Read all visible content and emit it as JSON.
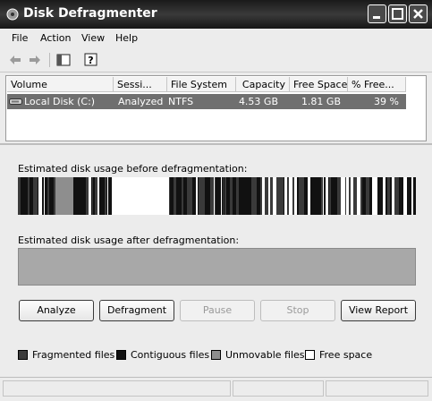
{
  "window": {
    "title": "Disk Defragmenter"
  },
  "menu": [
    "File",
    "Action",
    "View",
    "Help"
  ],
  "toolbar": {
    "back": "back-arrow-icon",
    "forward": "forward-arrow-icon",
    "show_hide": "show-hide-console-tree-icon",
    "help": "help-icon"
  },
  "table": {
    "columns": [
      "Volume",
      "Sessi...",
      "File System",
      "Capacity",
      "Free Space",
      "% Free..."
    ],
    "rows": [
      {
        "volume": "Local Disk (C:)",
        "session": "Analyzed",
        "file_system": "NTFS",
        "capacity": "4.53 GB",
        "free_space": "1.81 GB",
        "percent_free": "39 %"
      }
    ]
  },
  "before_label": "Estimated disk usage before defragmentation:",
  "after_label": "Estimated disk usage after defragmentation:",
  "buttons": {
    "analyze": "Analyze",
    "defragment": "Defragment",
    "pause": "Pause",
    "stop": "Stop",
    "view_report": "View Report"
  },
  "legend": [
    {
      "label": "Fragmented files",
      "color": "#3a3a3a"
    },
    {
      "label": "Contiguous files",
      "color": "#111111"
    },
    {
      "label": "Unmovable files",
      "color": "#8e8e8e"
    },
    {
      "label": "Free space",
      "color": "#ffffff"
    }
  ],
  "colors": {
    "titlebar": "#2a2a2a",
    "selected_row": "#6f6f6f",
    "after_map": "#a8a8a8"
  }
}
